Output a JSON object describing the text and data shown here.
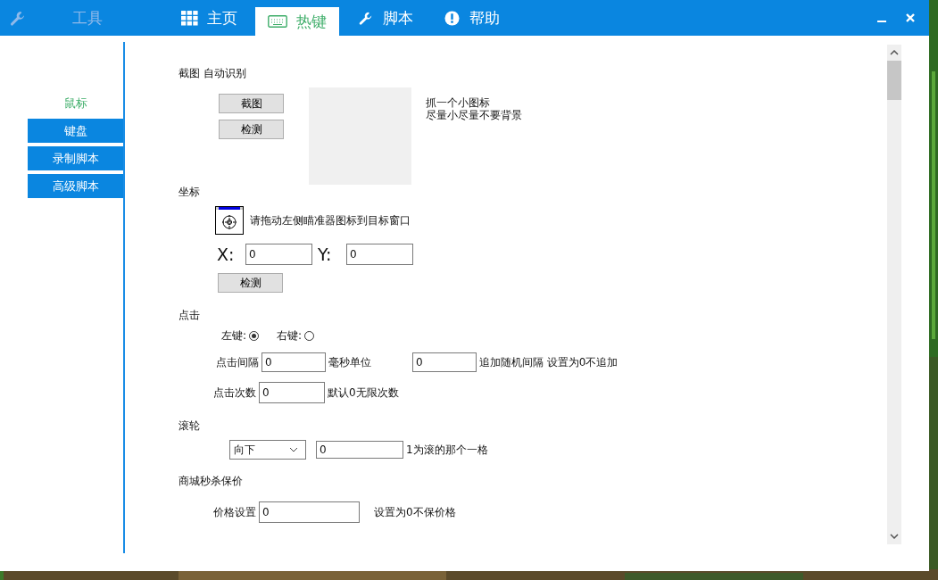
{
  "title_bar": {
    "app_label": "工具",
    "tabs": [
      {
        "label": "主页",
        "selected": false
      },
      {
        "label": "热键",
        "selected": true
      },
      {
        "label": "脚本",
        "selected": false
      },
      {
        "label": "帮助",
        "selected": false
      }
    ]
  },
  "sidebar": {
    "items": [
      {
        "label": "鼠标",
        "selected": true
      },
      {
        "label": "键盘",
        "selected": false
      },
      {
        "label": "录制脚本",
        "selected": false
      },
      {
        "label": "高级脚本",
        "selected": false
      }
    ]
  },
  "capture": {
    "title": "截图 自动识别",
    "buttons": [
      "截图",
      "检测"
    ],
    "hints": [
      "抓一个小图标",
      "尽量小尽量不要背景"
    ]
  },
  "coords": {
    "title": "坐标",
    "instruction": "请拖动左侧瞄准器图标到目标窗口",
    "x_label": "X:",
    "x_value": "0",
    "y_label": "Y:",
    "y_value": "0",
    "button": "检测"
  },
  "click": {
    "title": "点击",
    "options": [
      {
        "label": "左键:",
        "selected": true
      },
      {
        "label": "右键:",
        "selected": false
      }
    ],
    "interval_label": "点击间隔",
    "interval_value": "0",
    "interval_unit": "毫秒单位",
    "random_value": "0",
    "random_note": "追加随机间隔 设置为0不追加",
    "count_label": "点击次数",
    "count_value": "0",
    "count_note": "默认0无限次数"
  },
  "wheel": {
    "title": "滚轮",
    "direction": "向下",
    "value": "0",
    "note": "1为滚的那个一格"
  },
  "price": {
    "title": "商城秒杀保价",
    "label": "价格设置",
    "value": "0",
    "note": "设置为0不保价格"
  }
}
